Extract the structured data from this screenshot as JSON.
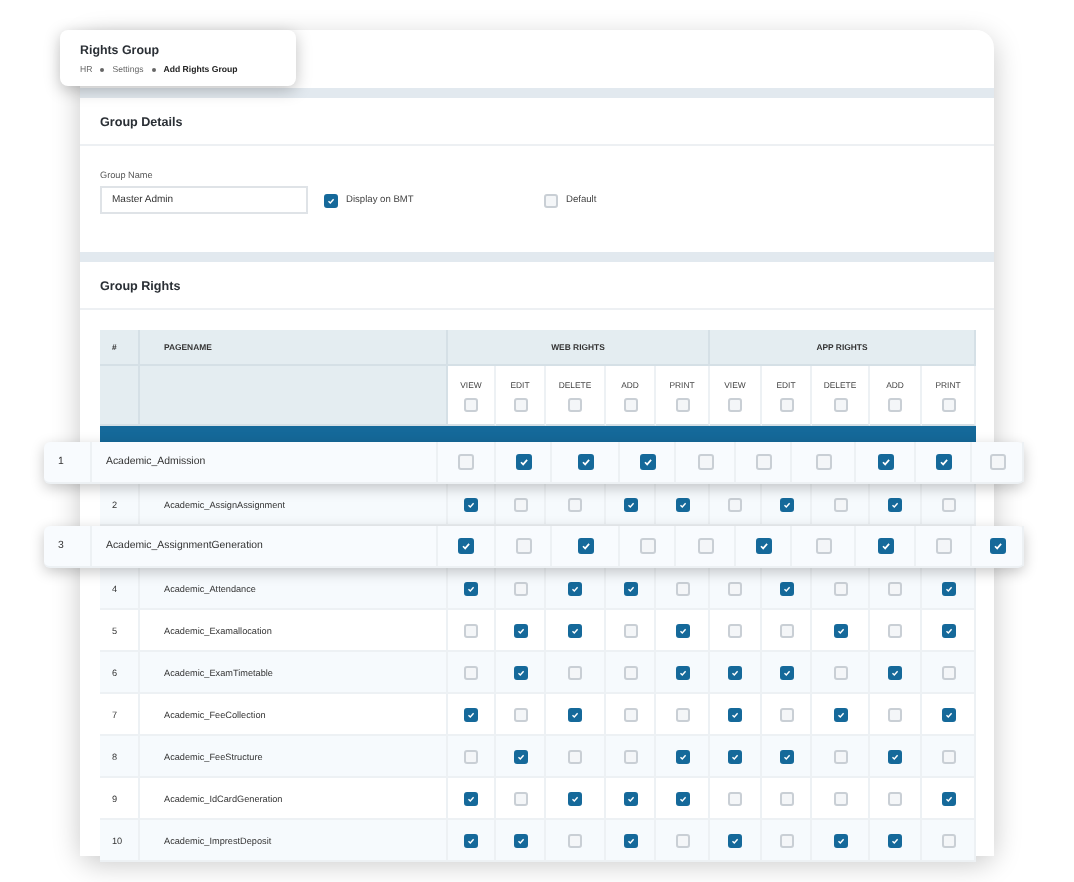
{
  "header": {
    "title": "Rights Group",
    "breadcrumb": [
      {
        "label": "HR",
        "current": false
      },
      {
        "label": "Settings",
        "current": false
      },
      {
        "label": "Add Rights Group",
        "current": true
      }
    ]
  },
  "group_details": {
    "title": "Group Details",
    "group_name": {
      "label": "Group Name",
      "value": "Master Admin"
    },
    "options": [
      {
        "label": "Display on BMT",
        "checked": true
      },
      {
        "label": "Default",
        "checked": false
      }
    ]
  },
  "group_rights": {
    "title": "Group Rights",
    "columns": {
      "number": "#",
      "page": "PAGENAME"
    },
    "groups": [
      {
        "label": "WEB RIGHTS",
        "columns": [
          {
            "label": "VIEW",
            "checked": false
          },
          {
            "label": "EDIT",
            "checked": false
          },
          {
            "label": "DELETE",
            "checked": false
          },
          {
            "label": "ADD",
            "checked": false
          },
          {
            "label": "PRINT",
            "checked": false
          }
        ]
      },
      {
        "label": "APP RIGHTS",
        "columns": [
          {
            "label": "VIEW",
            "checked": false
          },
          {
            "label": "EDIT",
            "checked": false
          },
          {
            "label": "DELETE",
            "checked": false
          },
          {
            "label": "ADD",
            "checked": false
          },
          {
            "label": "PRINT",
            "checked": false
          }
        ]
      }
    ],
    "rows": [
      {
        "number": "1",
        "page": "Academic_Admission",
        "highlighted": true,
        "rights": [
          false,
          true,
          true,
          true,
          false,
          false,
          false,
          true,
          true,
          false
        ]
      },
      {
        "number": "2",
        "page": "Academic_AssignAssignment",
        "highlighted": false,
        "rights": [
          true,
          false,
          false,
          true,
          true,
          false,
          true,
          false,
          true,
          false
        ]
      },
      {
        "number": "3",
        "page": "Academic_AssignmentGeneration",
        "highlighted": true,
        "rights": [
          true,
          false,
          true,
          false,
          false,
          true,
          false,
          true,
          false,
          true
        ]
      },
      {
        "number": "4",
        "page": "Academic_Attendance",
        "highlighted": false,
        "rights": [
          true,
          false,
          true,
          true,
          false,
          false,
          true,
          false,
          false,
          true
        ]
      },
      {
        "number": "5",
        "page": "Academic_Examallocation",
        "highlighted": false,
        "rights": [
          false,
          true,
          true,
          false,
          true,
          false,
          false,
          true,
          false,
          true
        ]
      },
      {
        "number": "6",
        "page": "Academic_ExamTimetable",
        "highlighted": false,
        "rights": [
          false,
          true,
          false,
          false,
          true,
          true,
          true,
          false,
          true,
          false
        ]
      },
      {
        "number": "7",
        "page": "Academic_FeeCollection",
        "highlighted": false,
        "rights": [
          true,
          false,
          true,
          false,
          false,
          true,
          false,
          true,
          false,
          true
        ]
      },
      {
        "number": "8",
        "page": "Academic_FeeStructure",
        "highlighted": false,
        "rights": [
          false,
          true,
          false,
          false,
          true,
          true,
          true,
          false,
          true,
          false
        ]
      },
      {
        "number": "9",
        "page": "Academic_IdCardGeneration",
        "highlighted": false,
        "rights": [
          true,
          false,
          true,
          true,
          true,
          false,
          false,
          false,
          false,
          true
        ]
      },
      {
        "number": "10",
        "page": "Academic_ImprestDeposit",
        "highlighted": false,
        "rights": [
          true,
          true,
          false,
          true,
          false,
          true,
          false,
          true,
          true,
          false
        ]
      }
    ]
  }
}
